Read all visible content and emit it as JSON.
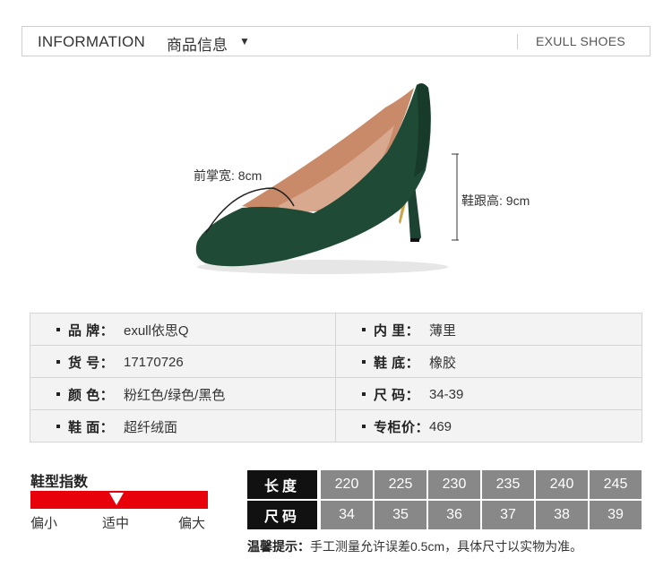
{
  "header": {
    "title_en": "INFORMATION",
    "title_cn": "商品信息",
    "caret": "▼",
    "brand": "EXULL SHOES"
  },
  "shoe": {
    "forefoot_width": "前掌宽: 8cm",
    "heel_height": "鞋跟高: 9cm",
    "colors": {
      "suede": "#1f4a36",
      "lining": "#c98a6a",
      "heel_accent": "#c8a44a"
    }
  },
  "spec": {
    "rows": [
      {
        "lkey": "品  牌：",
        "lval": "exull依思Q",
        "rkey": "内  里：",
        "rval": "薄里"
      },
      {
        "lkey": "货  号：",
        "lval": "17170726",
        "rkey": "鞋  底：",
        "rval": "橡胶"
      },
      {
        "lkey": "颜  色：",
        "lval": "粉红色/绿色/黑色",
        "rkey": "尺  码：",
        "rval": "34-39"
      },
      {
        "lkey": "鞋  面：",
        "lval": "超纤绒面",
        "rkey": "专柜价：",
        "rval": "469"
      }
    ]
  },
  "fit": {
    "title": "鞋型指数",
    "small": "偏小",
    "true": "适中",
    "large": "偏大",
    "bar_color": "#e8000b"
  },
  "sizes": {
    "length_label": "长度",
    "size_label": "尺码",
    "lengths": [
      "220",
      "225",
      "230",
      "235",
      "240",
      "245"
    ],
    "size_values": [
      "34",
      "35",
      "36",
      "37",
      "38",
      "39"
    ],
    "note_label": "温馨提示：",
    "note_text": "手工测量允许误差0.5cm，具体尺寸以实物为准。"
  }
}
